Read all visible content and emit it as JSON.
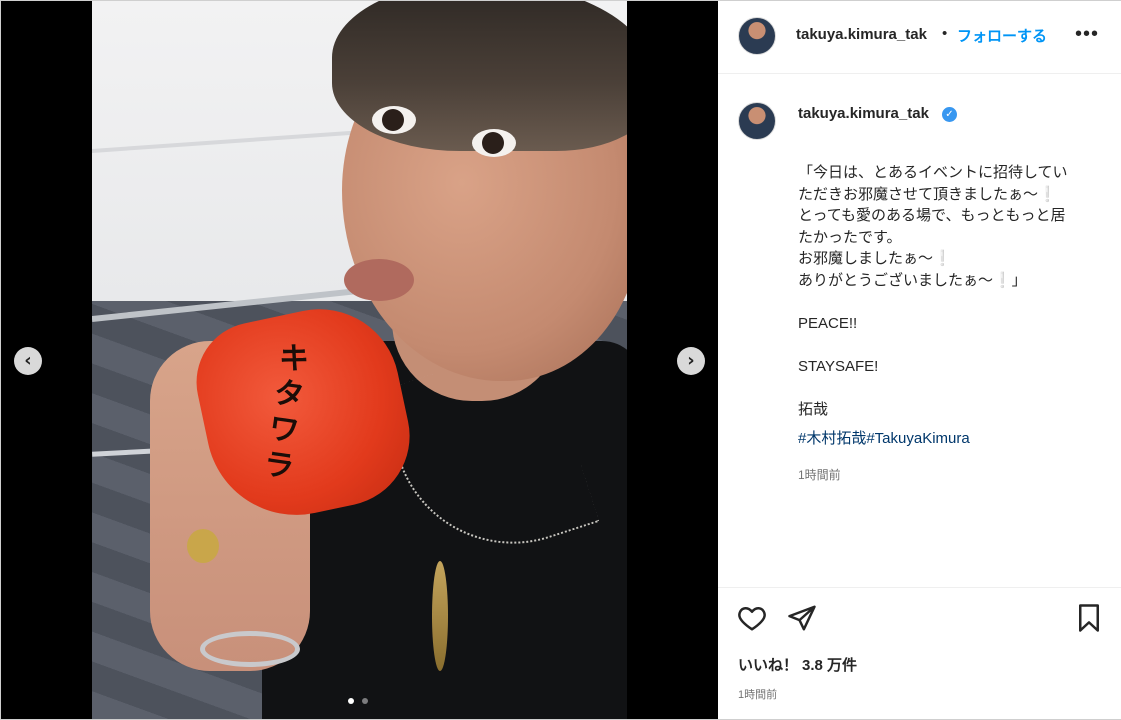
{
  "post": {
    "username": "takuya.kimura_tak",
    "separator": "•",
    "follow_label": "フォローする",
    "more_label": "•••",
    "verified_mark": "✓",
    "caption_lines": [
      "「今日は、とあるイベントに招待してい",
      "ただきお邪魔させて頂きましたぁ〜❕",
      "とっても愛のある場で、もっともっと居",
      "たかったです。",
      "お邪魔しましたぁ〜❕",
      "ありがとうございましたぁ〜❕」",
      "",
      "PEACE!!",
      "",
      "STAYSAFE!",
      "",
      "拓哉"
    ],
    "hashtags": [
      "#木村拓哉",
      "#TakuyaKimura"
    ],
    "caption_time": "1時間前",
    "likes_label": "いいね！",
    "likes_count": "3.8 万件",
    "post_time": "1時間前",
    "photo_text": "キタワラ"
  },
  "carousel": {
    "prev_icon": "chevron-left-icon",
    "next_icon": "chevron-right-icon",
    "prev_glyph": "‹",
    "next_glyph": "›",
    "total": 2,
    "active_index": 1
  },
  "colors": {
    "accent": "#0095f6",
    "hashtag": "#00376b",
    "verified": "#3897f0",
    "muted": "#737373"
  }
}
